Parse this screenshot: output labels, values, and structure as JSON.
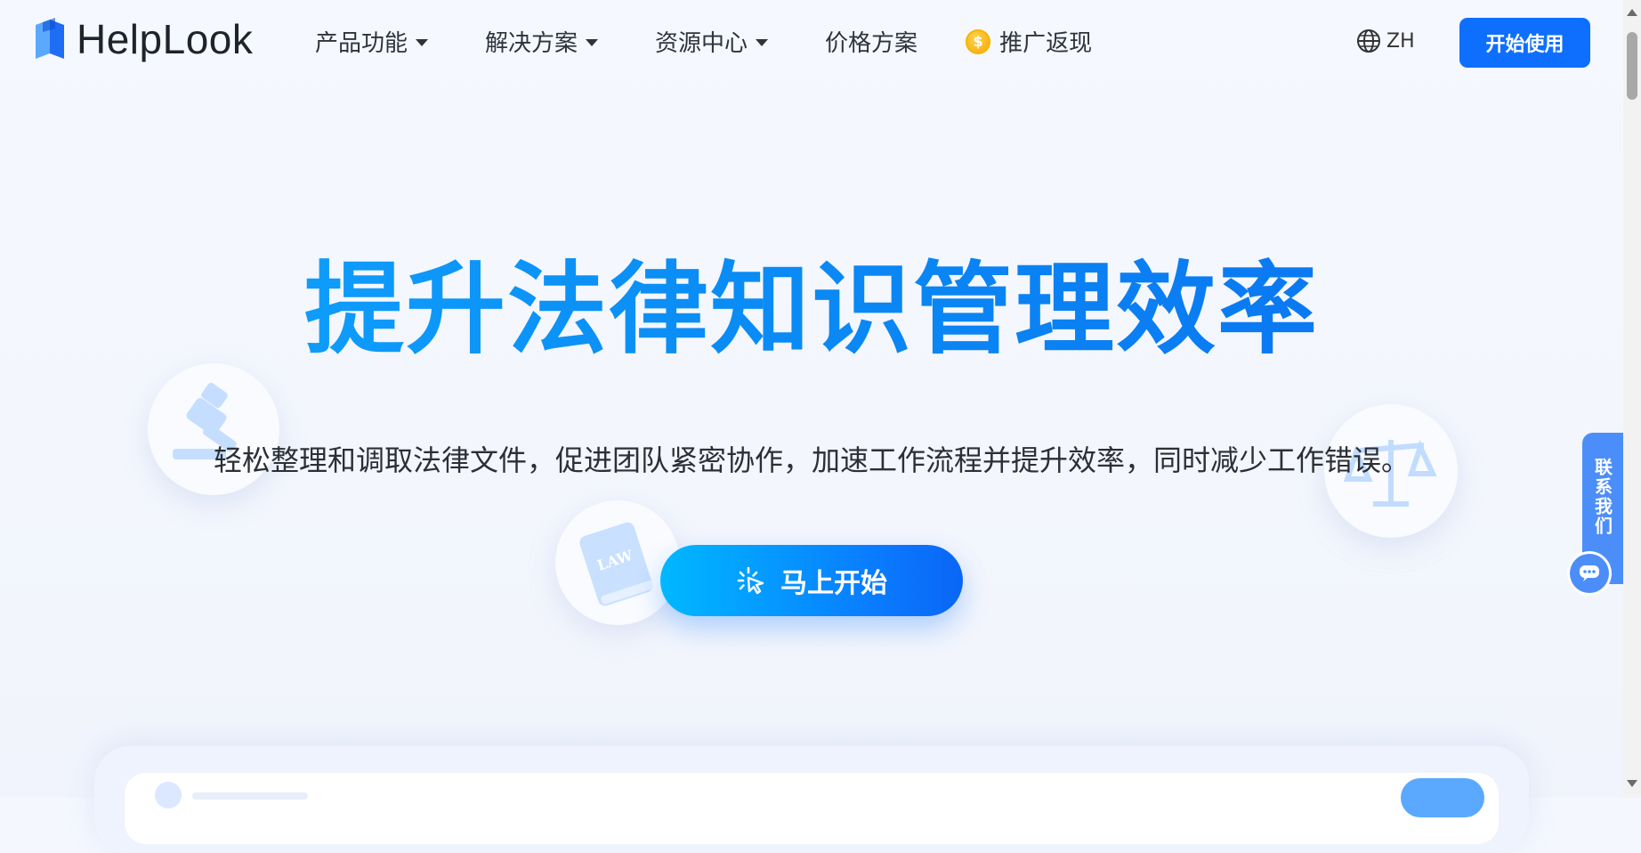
{
  "brand": {
    "name": "HelpLook",
    "accent": "#0e6fff"
  },
  "nav": {
    "items": [
      {
        "label": "产品功能",
        "dropdown": true
      },
      {
        "label": "解决方案",
        "dropdown": true
      },
      {
        "label": "资源中心",
        "dropdown": true
      },
      {
        "label": "价格方案",
        "dropdown": false
      },
      {
        "label": "推广返现",
        "dropdown": false,
        "icon": "coin-icon"
      }
    ],
    "lang_label": "ZH",
    "start_label": "开始使用"
  },
  "hero": {
    "title": "提升法律知识管理效率",
    "subtitle": "轻松整理和调取法律文件，促进团队紧密协作，加速工作流程并提升效率，同时减少工作错误。",
    "cta_label": "马上开始",
    "decor_icons": [
      "gavel-icon",
      "law-book-icon",
      "scales-icon"
    ]
  },
  "contact": {
    "label": "联系我们",
    "chat_icon": "chat-bubble-icon"
  }
}
